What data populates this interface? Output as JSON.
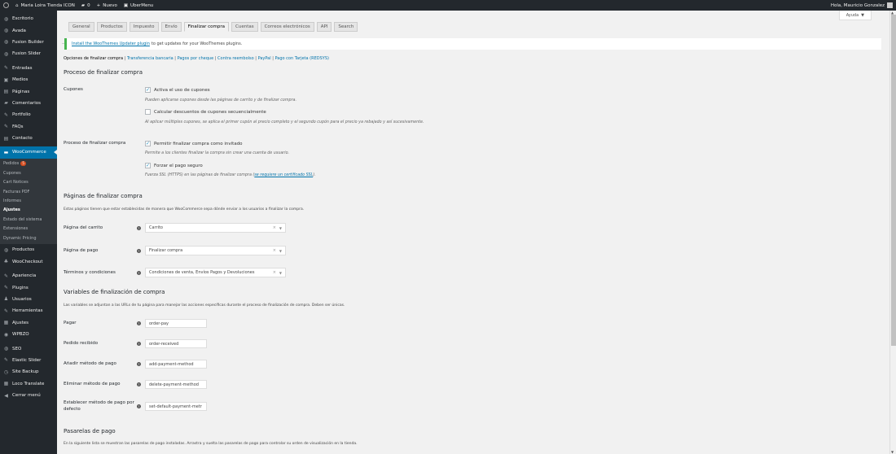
{
  "adminbar": {
    "site_name": "Maria Loira Tienda ICON",
    "comments_count": "0",
    "new_label": "Nuevo",
    "ubermenu_label": "UberMenu",
    "greeting": "Hola, Mauricio Gonzalez"
  },
  "sidebar": {
    "items_top": [
      {
        "label": "Escritorio",
        "icon": "dashboard-icon",
        "glyph": "◍"
      },
      {
        "label": "Avada",
        "icon": "avada-icon",
        "glyph": "◍"
      },
      {
        "label": "Fusion Builder",
        "icon": "fusion-builder-icon",
        "glyph": "◍"
      },
      {
        "label": "Fusion Slider",
        "icon": "fusion-slider-icon",
        "glyph": "◍"
      }
    ],
    "items_content": [
      {
        "label": "Entradas",
        "icon": "pin-icon",
        "glyph": "✎"
      },
      {
        "label": "Medios",
        "icon": "media-icon",
        "glyph": "▣"
      },
      {
        "label": "Páginas",
        "icon": "pages-icon",
        "glyph": "▤"
      },
      {
        "label": "Comentarios",
        "icon": "comments-icon",
        "glyph": "▰"
      },
      {
        "label": "Portfolio",
        "icon": "portfolio-icon",
        "glyph": "✎"
      },
      {
        "label": "FAQs",
        "icon": "faq-icon",
        "glyph": "✎"
      },
      {
        "label": "Contacto",
        "icon": "contact-icon",
        "glyph": "▤"
      }
    ],
    "woocommerce_label": "WooCommerce",
    "submenu": [
      {
        "label": "Pedidos",
        "badge": "5"
      },
      {
        "label": "Cupones"
      },
      {
        "label": "Cart Notices"
      },
      {
        "label": "Facturas PDF"
      },
      {
        "label": "Informes"
      },
      {
        "label": "Ajustes",
        "current": true
      },
      {
        "label": "Estado del sistema"
      },
      {
        "label": "Extensiones"
      },
      {
        "label": "Dynamic Pricing"
      }
    ],
    "items_after": [
      {
        "label": "Productos",
        "icon": "products-icon",
        "glyph": "◍"
      },
      {
        "label": "WooCheckout",
        "icon": "woocheckout-icon",
        "glyph": "♣"
      }
    ],
    "items_appearance": [
      {
        "label": "Apariencia",
        "icon": "appearance-icon",
        "glyph": "✎"
      },
      {
        "label": "Plugins",
        "icon": "plugins-icon",
        "glyph": "✎"
      },
      {
        "label": "Usuarios",
        "icon": "users-icon",
        "glyph": "♟"
      },
      {
        "label": "Herramientas",
        "icon": "tools-icon",
        "glyph": "✎"
      },
      {
        "label": "Ajustes",
        "icon": "settings-icon",
        "glyph": "▦"
      },
      {
        "label": "WPBZO",
        "icon": "wpbzo-icon",
        "glyph": "◉"
      }
    ],
    "items_bottom": [
      {
        "label": "SEO",
        "icon": "seo-icon",
        "glyph": "◍"
      },
      {
        "label": "Elastic Slider",
        "icon": "elastic-slider-icon",
        "glyph": "✎"
      },
      {
        "label": "Site Backup",
        "icon": "backup-icon",
        "glyph": "◷"
      },
      {
        "label": "Loco Translate",
        "icon": "loco-icon",
        "glyph": "▦"
      },
      {
        "label": "Cerrar menú",
        "icon": "collapse-icon",
        "glyph": "◀"
      }
    ]
  },
  "help_label": "Ayuda",
  "tabs": [
    "General",
    "Productos",
    "Impuesto",
    "Envío",
    "Finalizar compra",
    "Cuentas",
    "Correos electrónicos",
    "API",
    "Search"
  ],
  "active_tab": "Finalizar compra",
  "notice": {
    "link": "Install the WooThemes Updater plugin",
    "text": "to get updates for your WooThemes plugins."
  },
  "subsubsub": [
    {
      "label": "Opciones de finalizar compra",
      "current": true
    },
    {
      "label": "Transferencia bancaria"
    },
    {
      "label": "Pagos por cheque"
    },
    {
      "label": "Contra reembolso"
    },
    {
      "label": "PayPal"
    },
    {
      "label": "Pago con Tarjeta (REDSYS)"
    }
  ],
  "section1": {
    "title": "Proceso de finalizar compra",
    "cupones_label": "Cupones",
    "cb_coupons": "Activa el uso de cupones",
    "cb_coupons_desc": "Pueden aplicarse cupones desde las páginas de carrito y de finalizar compra.",
    "cb_sequential": "Calcular descuentos de cupones secuencialmente",
    "cb_sequential_desc": "Al aplicar múltiples cupones, se aplica el primer cupón al precio completo y el segundo cupón para el precio ya rebajado y así sucesivamente.",
    "process_label": "Proceso de finalizar compra",
    "cb_guest": "Permitir finalizar compra como invitado",
    "cb_guest_desc": "Permite a los clientes finalizar la compra sin crear una cuenta de usuario.",
    "cb_ssl": "Forzar el pago seguro",
    "cb_ssl_desc": "Fuerza SSL (HTTPS) en las páginas de finalizar compra (",
    "cb_ssl_link": "se requiere un certificado SSL",
    "cb_ssl_end": ")."
  },
  "section2": {
    "title": "Páginas de finalizar compra",
    "desc": "Estas páginas tienen que estar establecidas de manera que WooCommerce sepa dónde enviar a los usuarios a finalizar la compra.",
    "rows": [
      {
        "label": "Página del carrito",
        "value": "Carrito"
      },
      {
        "label": "Página de pago",
        "value": "Finalizar compra"
      },
      {
        "label": "Términos y condiciones",
        "value": "Condiciones de venta, Envíos Pagos y Devoluciones"
      }
    ]
  },
  "section3": {
    "title": "Variables de finalización de compra",
    "desc": "Las variables se adjuntan a las URLs de tu página para manejar las acciones específicas durante el proceso de finalización de compra. Deben ser únicas.",
    "rows": [
      {
        "label": "Pagar",
        "value": "order-pay"
      },
      {
        "label": "Pedido recibido",
        "value": "order-received"
      },
      {
        "label": "Añadir método de pago",
        "value": "add-payment-method"
      },
      {
        "label": "Eliminar método de pago",
        "value": "delete-payment-method"
      },
      {
        "label_line1": "Establecer método de pago por",
        "label_line2": "defecto",
        "value": "set-default-payment-metr"
      }
    ]
  },
  "section4": {
    "title": "Pasarelas de pago",
    "desc": "En la siguiente lista se muestran las pasarelas de pago instaladas. Arrastra y suelta las pasarelas de pago para controlar su orden de visualización en la tienda."
  },
  "colors": {
    "accent": "#0073aa",
    "admin_bg": "#23282d",
    "notice_green": "#46b450"
  }
}
